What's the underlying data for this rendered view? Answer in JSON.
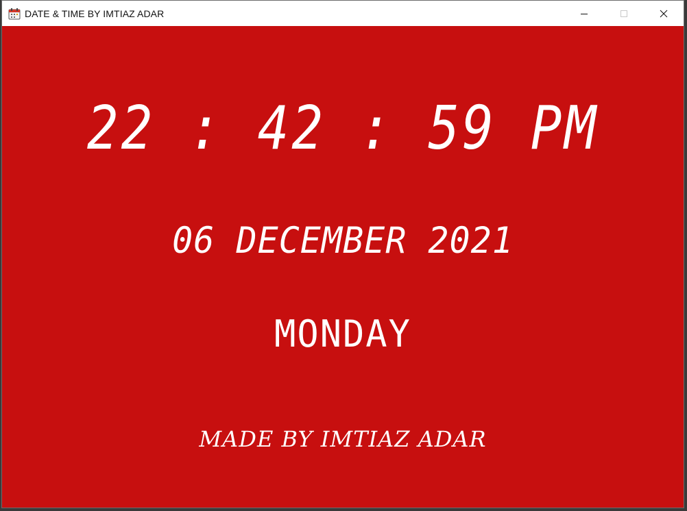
{
  "window": {
    "title": "DATE & TIME BY IMTIAZ ADAR",
    "app_icon": "calendar-icon",
    "controls": [
      "minimize-icon",
      "maximize-icon",
      "close-icon"
    ],
    "background_color": "#c70f0f"
  },
  "clock": {
    "time": "22 : 42 : 59 PM",
    "date": "06 DECEMBER 2021",
    "day": "MONDAY"
  },
  "footer": {
    "credit": "MADE BY IMTIAZ ADAR"
  }
}
